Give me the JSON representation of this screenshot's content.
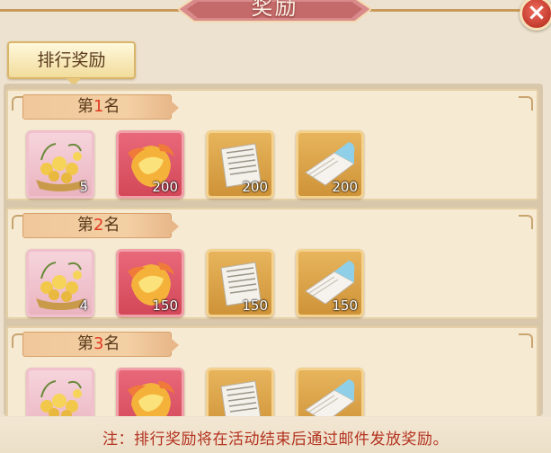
{
  "window": {
    "title": "奖励",
    "close_icon": "close-icon"
  },
  "tab": {
    "label": "排行奖励"
  },
  "ranks": [
    {
      "prefix": "第",
      "number": "1",
      "suffix": "名",
      "items": [
        {
          "icon": "flower-basket-icon",
          "count": "5"
        },
        {
          "icon": "golden-mask-icon",
          "count": "200"
        },
        {
          "icon": "paper-scroll-icon",
          "count": "200"
        },
        {
          "icon": "blue-scroll-book-icon",
          "count": "200"
        }
      ]
    },
    {
      "prefix": "第",
      "number": "2",
      "suffix": "名",
      "items": [
        {
          "icon": "flower-basket-icon",
          "count": "4"
        },
        {
          "icon": "golden-mask-icon",
          "count": "150"
        },
        {
          "icon": "paper-scroll-icon",
          "count": "150"
        },
        {
          "icon": "blue-scroll-book-icon",
          "count": "150"
        }
      ]
    },
    {
      "prefix": "第",
      "number": "3",
      "suffix": "名",
      "items": [
        {
          "icon": "flower-basket-icon",
          "count": ""
        },
        {
          "icon": "golden-mask-icon",
          "count": ""
        },
        {
          "icon": "paper-scroll-icon",
          "count": ""
        },
        {
          "icon": "blue-scroll-book-icon",
          "count": ""
        }
      ]
    }
  ],
  "footer": {
    "notice": "注：排行奖励将在活动结束后通过邮件发放奖励。"
  },
  "colors": {
    "accent_red": "#e03a22",
    "notice_red": "#b3321f",
    "panel": "#f6ead3"
  }
}
